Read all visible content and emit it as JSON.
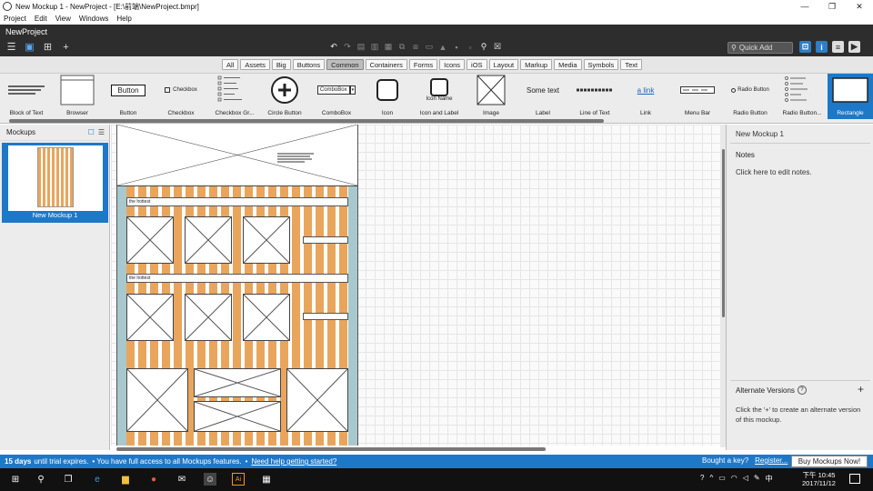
{
  "titlebar": {
    "title": "New Mockup 1 - NewProject - [E:\\前端\\NewProject.bmpr]",
    "minimize": "—",
    "maximize": "❐",
    "close": "✕"
  },
  "menu": {
    "items": [
      "Project",
      "Edit",
      "View",
      "Windows",
      "Help"
    ]
  },
  "project": {
    "name": "NewProject"
  },
  "toolbar": {
    "quick_add_placeholder": "Quick Add"
  },
  "filters": {
    "tabs": [
      "All",
      "Assets",
      "Big",
      "Buttons",
      "Common",
      "Containers",
      "Forms",
      "Icons",
      "iOS",
      "Layout",
      "Markup",
      "Media",
      "Symbols",
      "Text"
    ],
    "active": "Common"
  },
  "library": {
    "items": [
      {
        "label": "Block of Text"
      },
      {
        "label": "Browser"
      },
      {
        "label": "Button",
        "preview": "Button"
      },
      {
        "label": "Checkbox",
        "preview": "Checkbox"
      },
      {
        "label": "Checkbox Gr..."
      },
      {
        "label": "Circle Button"
      },
      {
        "label": "ComboBox",
        "preview": "ComboBox"
      },
      {
        "label": "Icon"
      },
      {
        "label": "Icon and Label",
        "preview": "Icon Name"
      },
      {
        "label": "Image"
      },
      {
        "label": "Label",
        "preview": "Some text"
      },
      {
        "label": "Line of Text"
      },
      {
        "label": "Link",
        "preview": "a link"
      },
      {
        "label": "Menu Bar"
      },
      {
        "label": "Radio Button",
        "preview": "Radio Button"
      },
      {
        "label": "Radio Button..."
      },
      {
        "label": "Rectangle"
      }
    ],
    "selected": "Rectangle"
  },
  "mockups_panel": {
    "title": "Mockups",
    "items": [
      {
        "name": "New Mockup 1",
        "selected": true
      }
    ]
  },
  "mockup": {
    "section_labels": [
      "the hottest",
      "the hottest"
    ],
    "stripe_color": "#e9a55c"
  },
  "properties": {
    "mockup_name": "New Mockup 1",
    "notes_title": "Notes",
    "notes_hint": "Click here to edit notes.",
    "alt_title": "Alternate Versions",
    "alt_hint": "Click the '+' to create an alternate version of this mockup."
  },
  "trial": {
    "days": "15 days",
    "msg1": "until trial expires.",
    "msg2": "• You have full access to all Mockups features.",
    "link": "Need help getting started?",
    "buy_key_text": "Bought a key?",
    "register": "Register...",
    "buy_button": "Buy Mockups Now!"
  },
  "taskbar": {
    "time": "10:45",
    "ampm": "下午",
    "date": "2017/11/12",
    "lang": "中"
  },
  "colors": {
    "accent": "#1e78c8",
    "dark": "#2d2d2d",
    "stripe": "#e9a55c"
  }
}
